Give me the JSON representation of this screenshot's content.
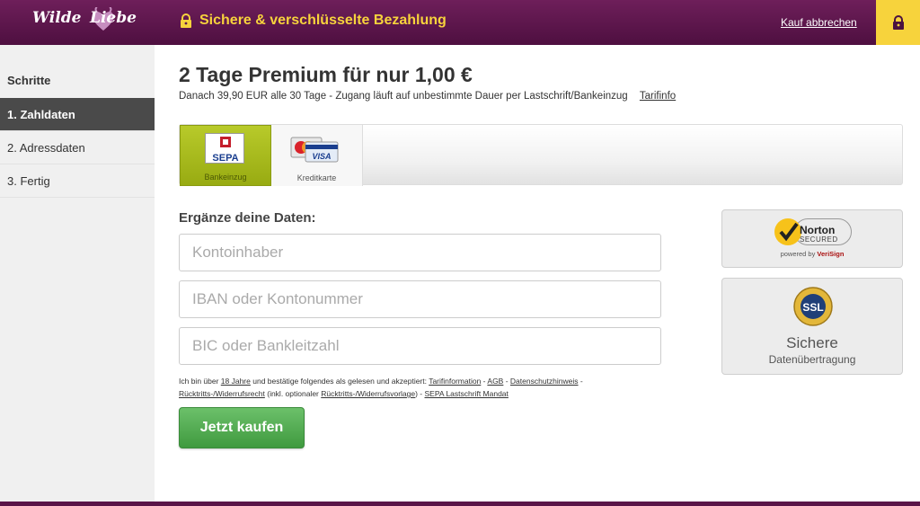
{
  "header": {
    "logo_left": "Wilde",
    "logo_right": "Liebe",
    "secure_title": "Sichere & verschlüsselte Bezahlung",
    "cancel_label": "Kauf abbrechen"
  },
  "sidebar": {
    "title": "Schritte",
    "steps": [
      {
        "label": "1. Zahldaten",
        "active": true
      },
      {
        "label": "2. Adressdaten",
        "active": false
      },
      {
        "label": "3. Fertig",
        "active": false
      }
    ]
  },
  "main": {
    "title": "2 Tage Premium für nur 1,00 €",
    "subtitle": "Danach 39,90 EUR alle 30 Tage - Zugang läuft auf unbestimmte Dauer per Lastschrift/Bankeinzug",
    "tarif_link": "Tarifinfo",
    "tabs": [
      {
        "label": "Bankeinzug",
        "icon": "sepa-icon",
        "selected": true
      },
      {
        "label": "Kreditkarte",
        "icon": "credit-card-icon",
        "selected": false
      }
    ],
    "sepa_text": "SEPA",
    "form_heading": "Ergänze deine Daten:",
    "fields": {
      "owner_placeholder": "Kontoinhaber",
      "iban_placeholder": "IBAN oder Kontonummer",
      "bic_placeholder": "BIC oder Bankleitzahl"
    },
    "terms": {
      "t1": "Ich bin über ",
      "age_link": "18 Jahre",
      "t2": " und bestätige folgendes als gelesen und akzeptiert: ",
      "tarif_link": "Tarifinformation",
      "agb_link": "AGB",
      "privacy_link": "Datenschutzhinweis",
      "withdrawal_link": "Rücktritts-/Widerrufsrecht",
      "t3": " (inkl. optionaler ",
      "withdrawal_form_link": "Rücktritts-/Widerrufsvorlage",
      "t4": ") - ",
      "sepa_mandate_link": "SEPA Lastschrift Mandat",
      "sep": " - "
    },
    "buy_label": "Jetzt kaufen"
  },
  "badges": {
    "norton_name": "Norton",
    "norton_secured": "SECURED",
    "powered_by": "powered by ",
    "verisign": "VeriSign",
    "ssl_text": "SSL",
    "ssl_title": "Sichere",
    "ssl_sub": "Datenübertragung"
  },
  "colors": {
    "header_bg": "#5e1850",
    "accent_yellow": "#f7d33c",
    "tab_green": "#a6b91c",
    "buy_green": "#4faa4d",
    "sidebar_active": "#4a4a4a"
  }
}
